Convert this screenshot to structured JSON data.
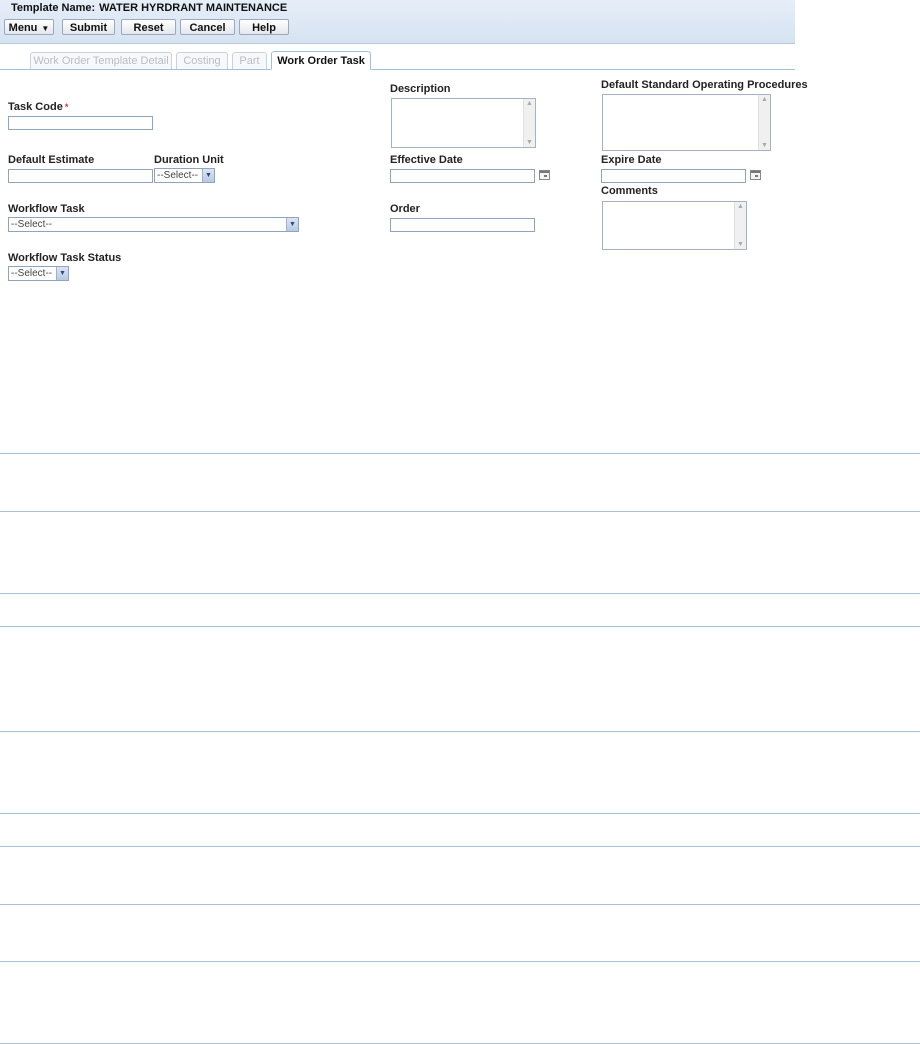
{
  "header": {
    "template_label": "Template Name:",
    "template_value": "WATER HYRDRANT MAINTENANCE"
  },
  "toolbar": {
    "menu_label": "Menu",
    "submit_label": "Submit",
    "reset_label": "Reset",
    "cancel_label": "Cancel",
    "help_label": "Help"
  },
  "tabs": [
    {
      "label": "Work Order Template Detail",
      "active": false
    },
    {
      "label": "Costing",
      "active": false
    },
    {
      "label": "Part",
      "active": false
    },
    {
      "label": "Work Order Task",
      "active": true
    }
  ],
  "form": {
    "task_code_label": "Task Code",
    "required_marker": "*",
    "task_code_value": "",
    "description_label": "Description",
    "description_value": "",
    "sop_label": "Default Standard Operating Procedures",
    "sop_value": "",
    "default_estimate_label": "Default Estimate",
    "default_estimate_value": "",
    "duration_unit_label": "Duration Unit",
    "duration_unit_value": "--Select--",
    "effective_date_label": "Effective Date",
    "effective_date_value": "",
    "expire_date_label": "Expire Date",
    "expire_date_value": "",
    "comments_label": "Comments",
    "comments_value": "",
    "workflow_task_label": "Workflow Task",
    "workflow_task_value": "--Select--",
    "order_label": "Order",
    "order_value": "",
    "workflow_task_status_label": "Workflow Task Status",
    "workflow_task_status_value": "--Select--"
  },
  "icons": {
    "menu_caret": "chevron-down-icon",
    "select_arrow": "chevron-down-icon",
    "calendar": "calendar-icon"
  },
  "colors": {
    "header_bg": "#dbe6f3",
    "tab_border": "#9fc0d8",
    "divider": "#a9bfd3",
    "required": "#dd3333"
  }
}
